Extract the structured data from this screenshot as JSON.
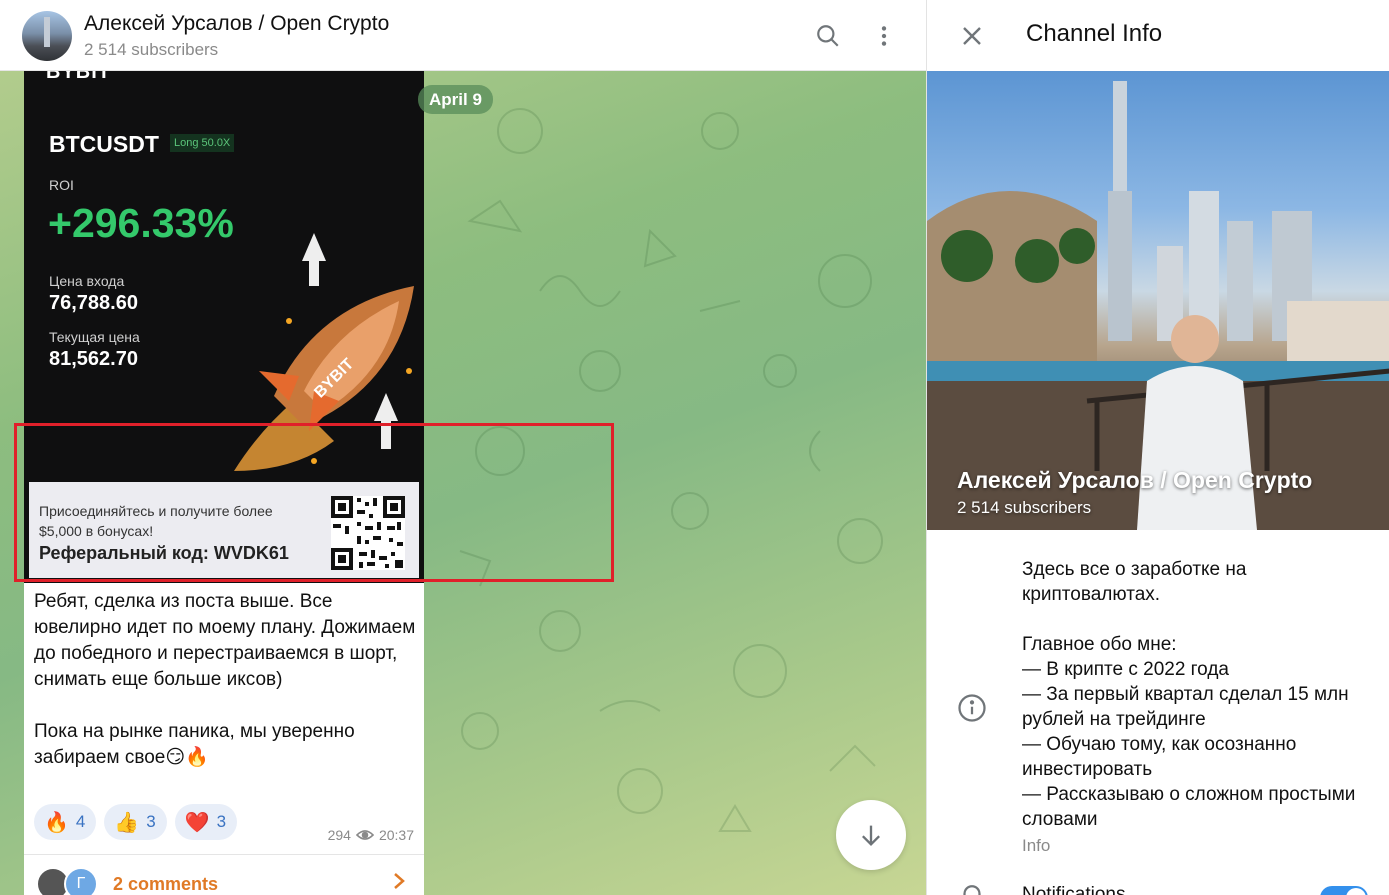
{
  "chat": {
    "title": "Алексей Урсалов / Open Crypto",
    "subscribers": "2 514 subscribers",
    "date": "April 9"
  },
  "card": {
    "brand": "BYBIT",
    "pair": "BTCUSDT",
    "position": "Long 50.0X",
    "roi_label": "ROI",
    "roi_value": "+296.33%",
    "entry_label": "Цена входа",
    "entry_value": "76,788.60",
    "current_label": "Текущая цена",
    "current_value": "81,562.70",
    "rocket_text": "BYBIT",
    "promo_text": "Присоединяйтесь и получите более $5,000 в бонусах!",
    "referral": "Реферальный код: WVDK61"
  },
  "message": {
    "text": "Ребят, сделка из поста выше. Все ювелирно идет по моему плану. Дожимаем до победного и перестраиваемся в шорт, снимать еще больше иксов)\n\nПока на рынке паника, мы уверенно забираем свое😏🔥",
    "reactions": [
      {
        "emoji": "🔥",
        "count": "4"
      },
      {
        "emoji": "👍",
        "count": "3"
      },
      {
        "emoji": "❤️",
        "count": "3"
      }
    ],
    "views": "294",
    "time": "20:37",
    "comments": "2 comments",
    "commenter_initial": "Г"
  },
  "info": {
    "title": "Channel Info",
    "name": "Алексей Урсалов / Open Crypto",
    "subscribers": "2 514 subscribers",
    "description": "Здесь все о заработке на криптовалютах.\n\nГлавное обо мне:\n— В крипте с 2022 года\n— За первый квартал сделал 15 млн рублей на трейдинге\n— Обучаю тому, как осознанно инвестировать\n— Рассказываю о сложном простыми словами",
    "description_label": "Info",
    "notifications": "Notifications"
  },
  "colors": {
    "accent": "#3390ec",
    "comments": "#e07a26",
    "roi_green": "#34c96b",
    "highlight": "#e0202a"
  },
  "icons": [
    "search-icon",
    "more-vertical-icon",
    "close-icon",
    "info-icon",
    "bell-icon",
    "eye-icon",
    "chevron-right-icon",
    "arrow-down-icon"
  ]
}
